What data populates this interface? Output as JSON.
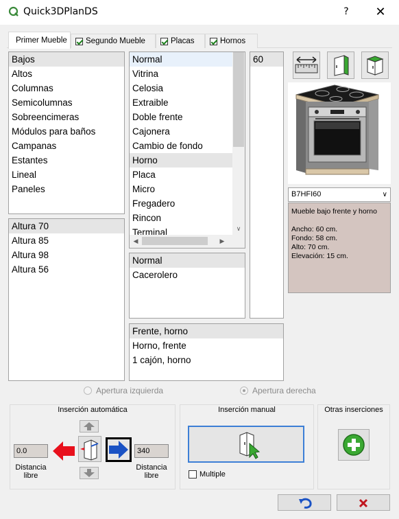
{
  "window": {
    "title": "Quick3DPlanDS",
    "help": "?",
    "close": "✕"
  },
  "tabs": [
    {
      "label": "Primer Mueble",
      "checked": false,
      "active": true
    },
    {
      "label": "Segundo Mueble",
      "checked": true
    },
    {
      "label": "Placas",
      "checked": true
    },
    {
      "label": "Hornos",
      "checked": true
    }
  ],
  "categories": [
    "Bajos",
    "Altos",
    "Columnas",
    "Semicolumnas",
    "Sobreencimeras",
    "Módulos para baños",
    "Campanas",
    "Estantes",
    "Lineal",
    "Paneles"
  ],
  "heights": [
    "Altura 70",
    "Altura 85",
    "Altura 98",
    "Altura 56"
  ],
  "types": [
    "Normal",
    "Vitrina",
    "Celosia",
    "Extraible",
    "Doble frente",
    "Cajonera",
    "Cambio de fondo",
    "Horno",
    "Placa",
    "Micro",
    "Fregadero",
    "Rincon",
    "Terminal"
  ],
  "widths": [
    "60"
  ],
  "subtypes": [
    "Normal",
    "Cacerolero"
  ],
  "fronts": [
    "Frente, horno",
    "Horno, frente",
    "1 cajón, horno"
  ],
  "model": {
    "selected": "B7HFI60"
  },
  "description": {
    "title": "Mueble bajo frente y horno",
    "ancho": "Ancho: 60 cm.",
    "fondo": "Fondo: 58 cm.",
    "alto": "Alto: 70 cm.",
    "elevacion": "Elevación: 15 cm."
  },
  "opening": {
    "left": "Apertura izquierda",
    "right": "Apertura derecha"
  },
  "auto_insert": {
    "title": "Inserción automática",
    "left_value": "0.0",
    "right_value": "340",
    "left_label_1": "Distancia",
    "left_label_2": "libre",
    "right_label_1": "Distancia",
    "right_label_2": "libre"
  },
  "manual_insert": {
    "title": "Inserción manual",
    "multiple": "Multiple"
  },
  "other_insert": {
    "title": "Otras inserciones"
  },
  "colors": {
    "accent_red": "#e8101c",
    "accent_blue": "#1a52c4",
    "green": "#3aa832",
    "desc_bg": "#d4c5c0"
  }
}
